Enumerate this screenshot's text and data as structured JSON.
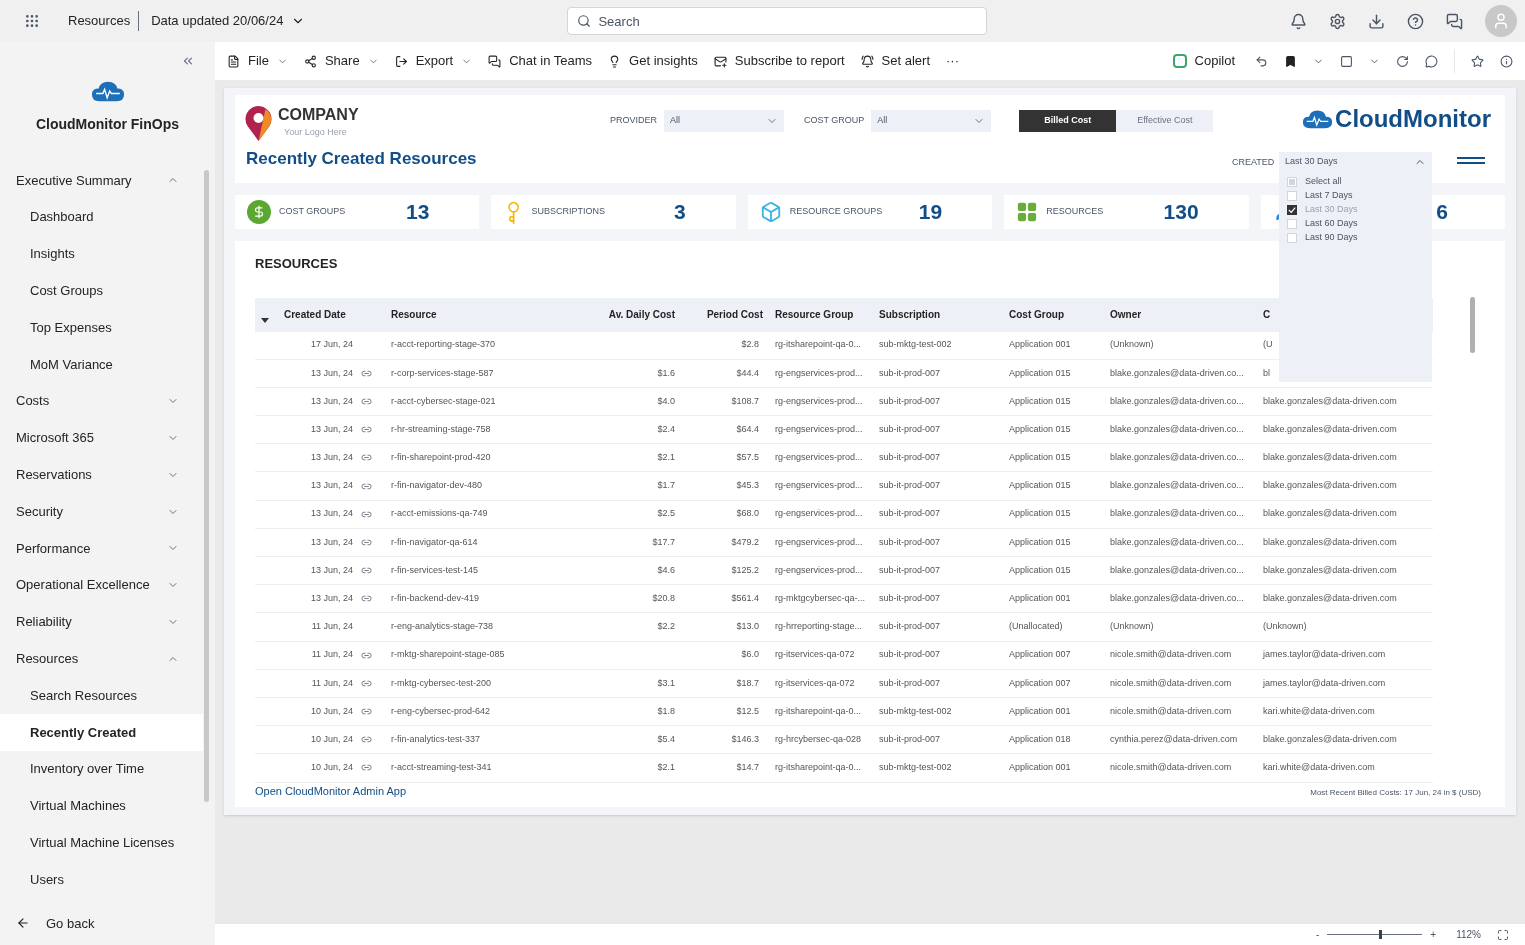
{
  "topbar": {
    "workspace": "Resources",
    "updated": "Data updated 20/06/24",
    "search": {
      "placeholder": "Search"
    }
  },
  "toolbar": {
    "left": [
      {
        "kind": "file",
        "label": "File",
        "caret": true
      },
      {
        "kind": "share",
        "label": "Share",
        "caret": true
      },
      {
        "kind": "export",
        "label": "Export",
        "caret": true
      },
      {
        "kind": "teams",
        "label": "Chat in Teams",
        "caret": false
      },
      {
        "kind": "insights",
        "label": "Get insights",
        "caret": false
      },
      {
        "kind": "subscribe",
        "label": "Subscribe to report",
        "caret": false
      },
      {
        "kind": "alert",
        "label": "Set alert",
        "caret": false
      },
      {
        "kind": "more",
        "label": "···",
        "caret": false
      }
    ],
    "copilot": "Copilot"
  },
  "sidebar": {
    "app_name": "CloudMonitor FinOps",
    "items": [
      {
        "label": "Executive Summary",
        "expanded": true,
        "selected": false,
        "children": [
          {
            "label": "Dashboard",
            "selected": false
          },
          {
            "label": "Insights",
            "selected": false
          },
          {
            "label": "Cost Groups",
            "selected": false
          },
          {
            "label": "Top Expenses",
            "selected": false
          },
          {
            "label": "MoM Variance",
            "selected": false
          }
        ]
      },
      {
        "label": "Costs",
        "expanded": false,
        "selected": false
      },
      {
        "label": "Microsoft 365",
        "expanded": false,
        "selected": false
      },
      {
        "label": "Reservations",
        "expanded": false,
        "selected": false
      },
      {
        "label": "Security",
        "expanded": false,
        "selected": false
      },
      {
        "label": "Performance",
        "expanded": false,
        "selected": false
      },
      {
        "label": "Operational Excellence",
        "expanded": false,
        "selected": false
      },
      {
        "label": "Reliability",
        "expanded": false,
        "selected": false
      },
      {
        "label": "Resources",
        "expanded": true,
        "selected": false,
        "children": [
          {
            "label": "Search Resources",
            "selected": false
          },
          {
            "label": "Recently Created",
            "selected": true
          },
          {
            "label": "Inventory over Time",
            "selected": false
          },
          {
            "label": "Virtual Machines",
            "selected": false
          },
          {
            "label": "Virtual Machine Licenses",
            "selected": false
          },
          {
            "label": "Users",
            "selected": false
          }
        ]
      }
    ],
    "go_back": "Go back"
  },
  "report": {
    "company": {
      "name": "COMPANY",
      "tagline": "Your Logo Here"
    },
    "title": "Recently Created Resources",
    "filters": [
      {
        "label": "PROVIDER",
        "value": "All"
      },
      {
        "label": "COST GROUP",
        "value": "All"
      }
    ],
    "cost_toggle": [
      {
        "label": "Billed Cost",
        "selected": true
      },
      {
        "label": "Effective Cost",
        "selected": false
      }
    ],
    "brand": "CloudMonitor",
    "created": {
      "label": "CREATED",
      "value": "Last 30 Days",
      "expanded": true,
      "options": [
        {
          "label": "Select all",
          "checked": false,
          "indeterminate": true
        },
        {
          "label": "Last 7 Days",
          "checked": false,
          "indeterminate": false
        },
        {
          "label": "Last 30 Days",
          "checked": true,
          "indeterminate": false
        },
        {
          "label": "Last 60 Days",
          "checked": false,
          "indeterminate": false
        },
        {
          "label": "Last 90 Days",
          "checked": false,
          "indeterminate": false
        }
      ]
    },
    "kpis": [
      {
        "kind": "cost",
        "label": "COST GROUPS",
        "value": "13"
      },
      {
        "kind": "key",
        "label": "SUBSCRIPTIONS",
        "value": "3"
      },
      {
        "kind": "cube",
        "label": "RESOURCE GROUPS",
        "value": "19"
      },
      {
        "kind": "grid",
        "label": "RESOURCES",
        "value": "130"
      },
      {
        "kind": "user",
        "value": "6"
      }
    ],
    "table": {
      "title": "RESOURCES",
      "columns": [
        "Created Date",
        "Resource",
        "Av. Daily Cost",
        "Period Cost",
        "Resource Group",
        "Subscription",
        "Cost Group",
        "Owner",
        "C"
      ],
      "rows": [
        {
          "date": "17 Jun, 24",
          "linked": false,
          "resource": "r-acct-reporting-stage-370",
          "period": "$2.8",
          "rg": "rg-itsharepoint-qa-0...",
          "sub": "sub-mktg-test-002",
          "cg": "Application 001",
          "owner": "(Unknown)",
          "col9": "(U"
        },
        {
          "date": "13 Jun, 24",
          "linked": true,
          "resource": "r-corp-services-stage-587",
          "daily": "$1.6",
          "period": "$44.4",
          "rg": "rg-engservices-prod...",
          "sub": "sub-it-prod-007",
          "cg": "Application 015",
          "owner": "blake.gonzales@data-driven.co...",
          "col9": "bl"
        },
        {
          "date": "13 Jun, 24",
          "linked": true,
          "resource": "r-acct-cybersec-stage-021",
          "daily": "$4.0",
          "period": "$108.7",
          "rg": "rg-engservices-prod...",
          "sub": "sub-it-prod-007",
          "cg": "Application 015",
          "owner": "blake.gonzales@data-driven.co...",
          "col9": "blake.gonzales@data-driven.com"
        },
        {
          "date": "13 Jun, 24",
          "linked": true,
          "resource": "r-hr-streaming-stage-758",
          "daily": "$2.4",
          "period": "$64.4",
          "rg": "rg-engservices-prod...",
          "sub": "sub-it-prod-007",
          "cg": "Application 015",
          "owner": "blake.gonzales@data-driven.co...",
          "col9": "blake.gonzales@data-driven.com"
        },
        {
          "date": "13 Jun, 24",
          "linked": true,
          "resource": "r-fin-sharepoint-prod-420",
          "daily": "$2.1",
          "period": "$57.5",
          "rg": "rg-engservices-prod...",
          "sub": "sub-it-prod-007",
          "cg": "Application 015",
          "owner": "blake.gonzales@data-driven.co...",
          "col9": "blake.gonzales@data-driven.com"
        },
        {
          "date": "13 Jun, 24",
          "linked": true,
          "resource": "r-fin-navigator-dev-480",
          "daily": "$1.7",
          "period": "$45.3",
          "rg": "rg-engservices-prod...",
          "sub": "sub-it-prod-007",
          "cg": "Application 015",
          "owner": "blake.gonzales@data-driven.co...",
          "col9": "blake.gonzales@data-driven.com"
        },
        {
          "date": "13 Jun, 24",
          "linked": true,
          "resource": "r-acct-emissions-qa-749",
          "daily": "$2.5",
          "period": "$68.0",
          "rg": "rg-engservices-prod...",
          "sub": "sub-it-prod-007",
          "cg": "Application 015",
          "owner": "blake.gonzales@data-driven.co...",
          "col9": "blake.gonzales@data-driven.com"
        },
        {
          "date": "13 Jun, 24",
          "linked": true,
          "resource": "r-fin-navigator-qa-614",
          "daily": "$17.7",
          "period": "$479.2",
          "rg": "rg-engservices-prod...",
          "sub": "sub-it-prod-007",
          "cg": "Application 015",
          "owner": "blake.gonzales@data-driven.co...",
          "col9": "blake.gonzales@data-driven.com"
        },
        {
          "date": "13 Jun, 24",
          "linked": true,
          "resource": "r-fin-services-test-145",
          "daily": "$4.6",
          "period": "$125.2",
          "rg": "rg-engservices-prod...",
          "sub": "sub-it-prod-007",
          "cg": "Application 015",
          "owner": "blake.gonzales@data-driven.co...",
          "col9": "blake.gonzales@data-driven.com"
        },
        {
          "date": "13 Jun, 24",
          "linked": true,
          "resource": "r-fin-backend-dev-419",
          "daily": "$20.8",
          "period": "$561.4",
          "rg": "rg-mktgcybersec-qa-...",
          "sub": "sub-it-prod-007",
          "cg": "Application 001",
          "owner": "blake.gonzales@data-driven.co...",
          "col9": "blake.gonzales@data-driven.com"
        },
        {
          "date": "11 Jun, 24",
          "linked": false,
          "resource": "r-eng-analytics-stage-738",
          "daily": "$2.2",
          "period": "$13.0",
          "rg": "rg-hrreporting-stage...",
          "sub": "sub-it-prod-007",
          "cg": "(Unallocated)",
          "owner": "(Unknown)",
          "col9": "(Unknown)"
        },
        {
          "date": "11 Jun, 24",
          "linked": true,
          "resource": "r-mktg-sharepoint-stage-085",
          "period": "$6.0",
          "rg": "rg-itservices-qa-072",
          "sub": "sub-it-prod-007",
          "cg": "Application 007",
          "owner": "nicole.smith@data-driven.com",
          "col9": "james.taylor@data-driven.com"
        },
        {
          "date": "11 Jun, 24",
          "linked": true,
          "resource": "r-mktg-cybersec-test-200",
          "daily": "$3.1",
          "period": "$18.7",
          "rg": "rg-itservices-qa-072",
          "sub": "sub-it-prod-007",
          "cg": "Application 007",
          "owner": "nicole.smith@data-driven.com",
          "col9": "james.taylor@data-driven.com"
        },
        {
          "date": "10 Jun, 24",
          "linked": true,
          "resource": "r-eng-cybersec-prod-642",
          "daily": "$1.8",
          "period": "$12.5",
          "rg": "rg-itsharepoint-qa-0...",
          "sub": "sub-mktg-test-002",
          "cg": "Application 001",
          "owner": "nicole.smith@data-driven.com",
          "col9": "kari.white@data-driven.com"
        },
        {
          "date": "10 Jun, 24",
          "linked": true,
          "resource": "r-fin-analytics-test-337",
          "daily": "$5.4",
          "period": "$146.3",
          "rg": "rg-hrcybersec-qa-028",
          "sub": "sub-it-prod-007",
          "cg": "Application 018",
          "owner": "cynthia.perez@data-driven.com",
          "col9": "blake.gonzales@data-driven.com"
        },
        {
          "date": "10 Jun, 24",
          "linked": true,
          "resource": "r-acct-streaming-test-341",
          "daily": "$2.1",
          "period": "$14.7",
          "rg": "rg-itsharepoint-qa-0...",
          "sub": "sub-mktg-test-002",
          "cg": "Application 001",
          "owner": "nicole.smith@data-driven.com",
          "col9": "kari.white@data-driven.com"
        }
      ]
    },
    "admin_link": "Open CloudMonitor Admin App",
    "footnote": "Most Recent Billed Costs: 17 Jun, 24 in $ (USD)"
  },
  "status_bar": {
    "zoom": {
      "level": 0.54,
      "reading": "112%"
    },
    "minus": "-",
    "plus": "+"
  }
}
